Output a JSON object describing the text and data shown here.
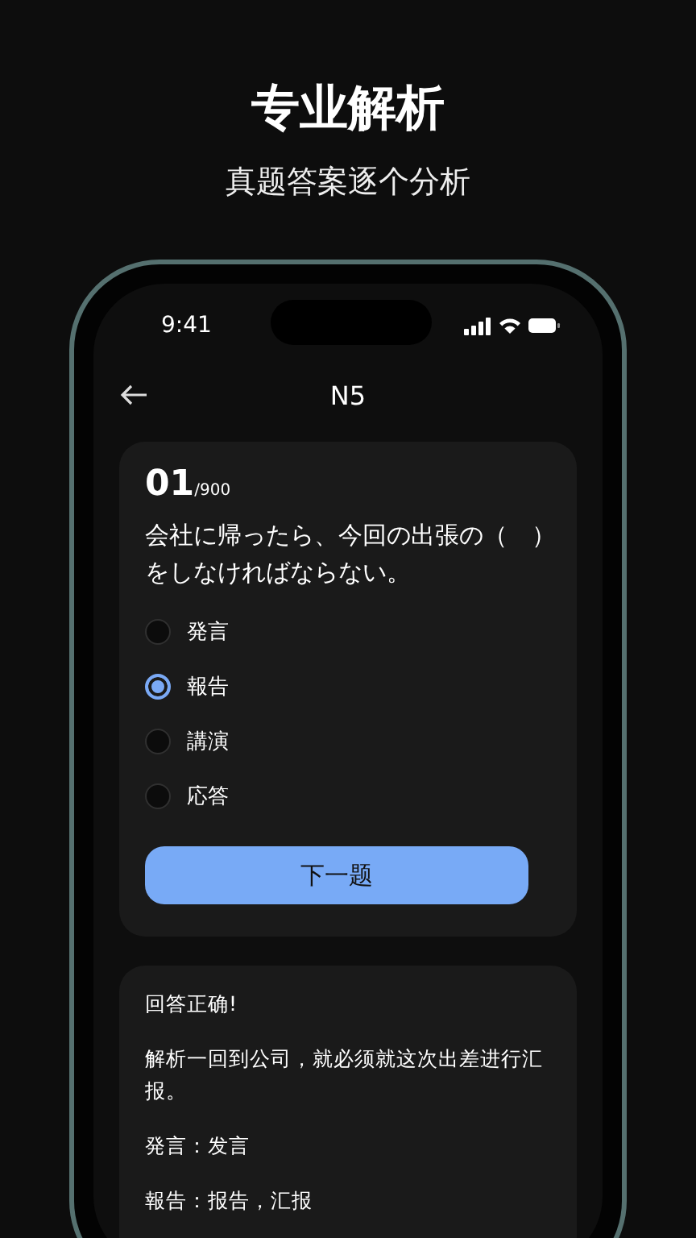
{
  "headline": "专业解析",
  "subheadline": "真题答案逐个分析",
  "status_bar": {
    "time": "9:41"
  },
  "nav": {
    "title": "N5"
  },
  "question": {
    "number": "01",
    "total": "/900",
    "text": "会社に帰ったら、今回の出張の（　）をしなければならない。",
    "options": [
      {
        "label": "発言",
        "selected": false
      },
      {
        "label": "報告",
        "selected": true
      },
      {
        "label": "講演",
        "selected": false
      },
      {
        "label": "応答",
        "selected": false
      }
    ],
    "next_button": "下一题"
  },
  "analysis": {
    "paragraphs": [
      "回答正确!",
      "解析一回到公司，就必须就这次出差进行汇报。",
      "発言：发言",
      "報告：报告，汇报"
    ]
  }
}
